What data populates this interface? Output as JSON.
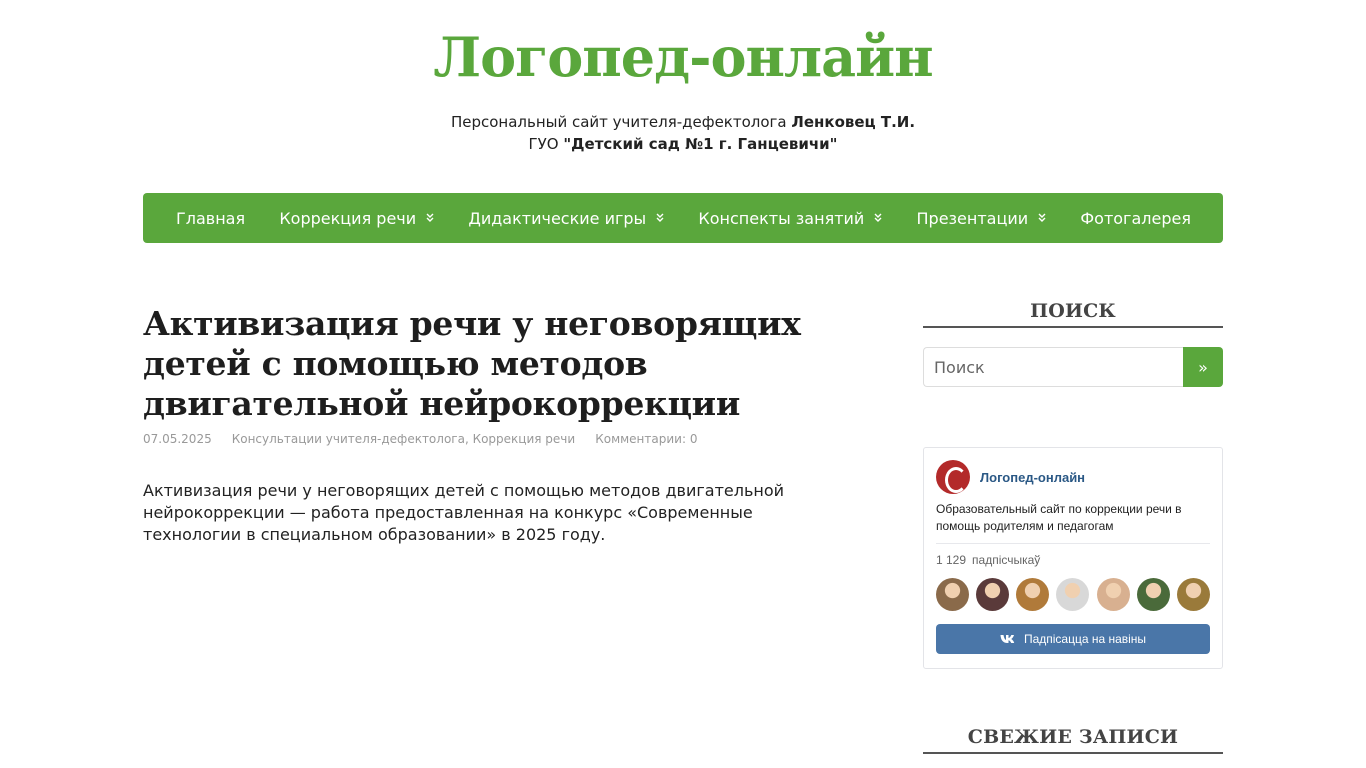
{
  "site": {
    "title": "Логопед-онлайн",
    "desc_line1_prefix": "Персональный сайт учителя-дефектолога ",
    "desc_line1_bold": "Ленковец Т.И.",
    "desc_line2_prefix": "ГУО ",
    "desc_line2_bold": "\"Детский сад №1 г. Ганцевичи\""
  },
  "nav": {
    "items": [
      {
        "label": "Главная"
      },
      {
        "label": "Коррекция речи"
      },
      {
        "label": "Дидактические игры"
      },
      {
        "label": "Конспекты занятий"
      },
      {
        "label": "Презентации"
      },
      {
        "label": "Фотогалерея"
      }
    ]
  },
  "post": {
    "title": "Активизация речи у неговорящих детей с помощью методов двигательной нейрокоррекции",
    "date": "07.05.2025",
    "categories": "Консультации учителя-дефектолога, Коррекция речи",
    "comments": "Комментарии: 0",
    "body": "Активизация речи у неговорящих детей с помощью методов двигательной нейрокоррекции — работа предоставленная на конкурс «Современные технологии в специальном образовании» в 2025 году."
  },
  "sidebar": {
    "search_title": "ПОИСК",
    "search_placeholder": "Поиск",
    "search_button": "»",
    "recent_title": "СВЕЖИЕ ЗАПИСИ"
  },
  "vk": {
    "name": "Логопед-онлайн",
    "desc": "Образовательный сайт по коррекции речи в помощь родителям и педагогам",
    "subs_count": "1 129",
    "subs_label": "падпісчыкаў",
    "button_label": "Падпісацца на навіны",
    "avatar_colors": [
      "#8a6a4a",
      "#5a3a3a",
      "#b07a3a",
      "#d8d8d8",
      "#d8b090",
      "#4a6a3a",
      "#9a7a3a"
    ]
  },
  "colors": {
    "accent": "#5aa73c",
    "vk_blue": "#4a76a8"
  }
}
